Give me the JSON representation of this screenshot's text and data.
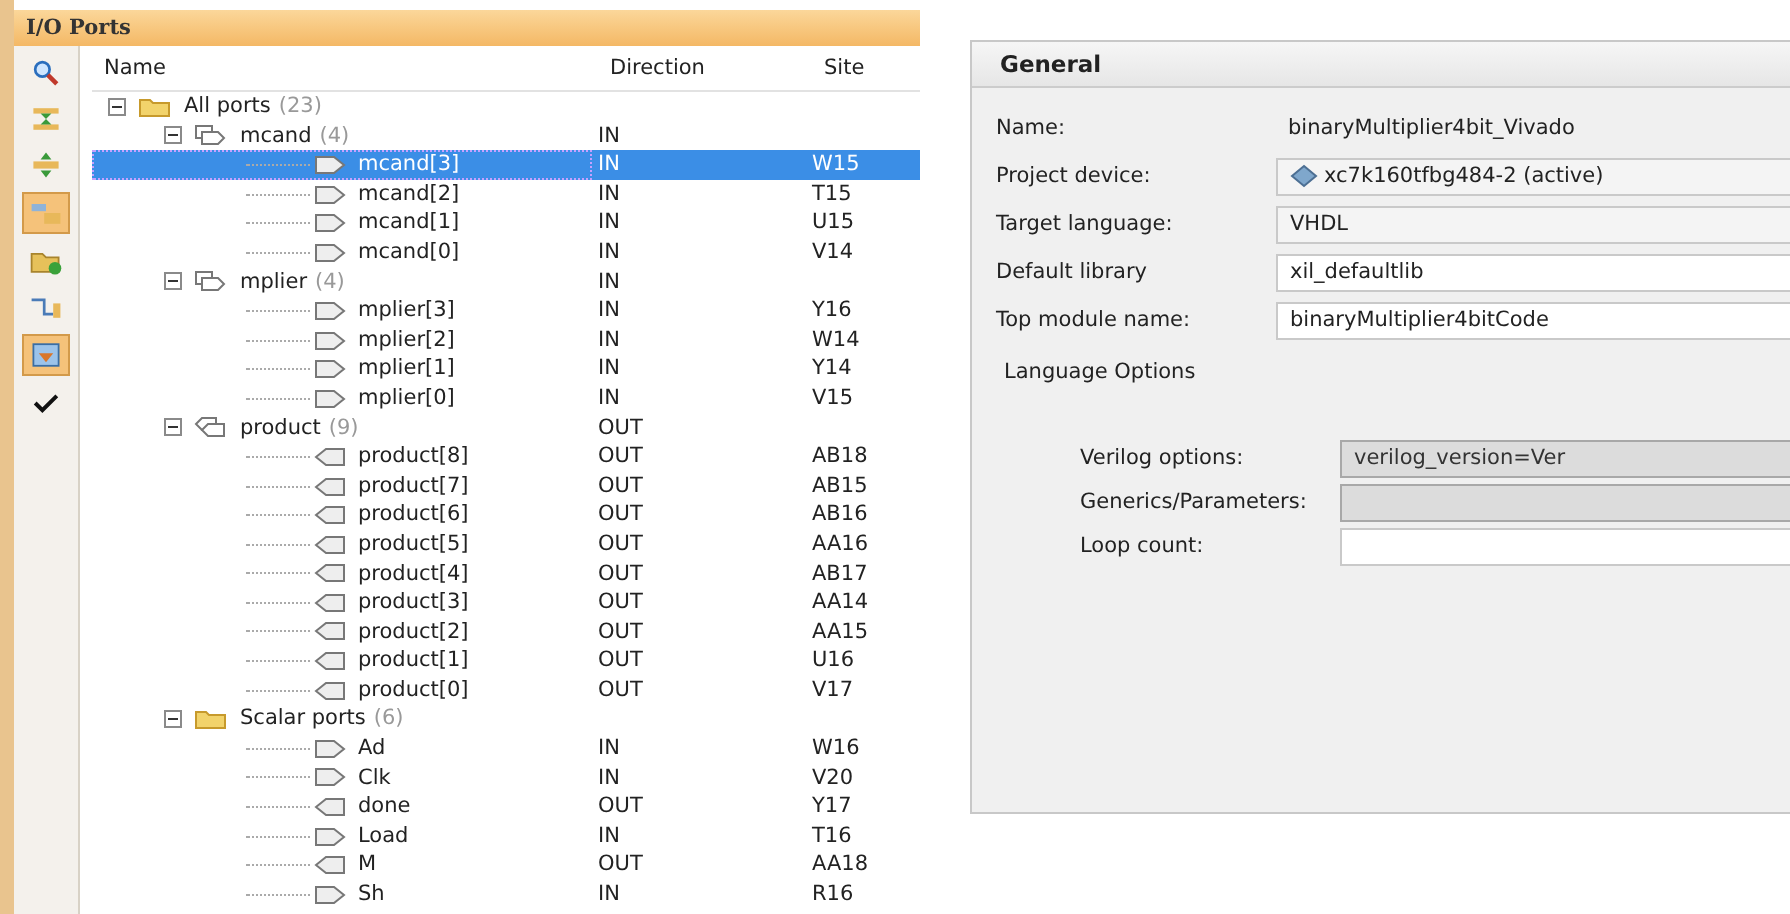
{
  "io_ports": {
    "title": "I/O Ports",
    "toolbar": [
      {
        "kind": "search",
        "on": false
      },
      {
        "kind": "collapse",
        "on": false
      },
      {
        "kind": "expand",
        "on": false
      },
      {
        "kind": "group",
        "on": true
      },
      {
        "kind": "folder_add",
        "on": false
      },
      {
        "kind": "wire",
        "on": false
      },
      {
        "kind": "import",
        "on": true
      },
      {
        "kind": "check",
        "on": false
      }
    ],
    "columns": [
      "Name",
      "Direction",
      "Site"
    ],
    "nodes": [
      {
        "kind": "folder",
        "name": "All ports",
        "count": "(23)",
        "expanded": true,
        "selected": false,
        "children": [
          {
            "kind": "bus_in",
            "name": "mcand",
            "count": "(4)",
            "direction": "IN",
            "expanded": true,
            "selected": false,
            "children": [
              {
                "kind": "in",
                "name": "mcand[3]",
                "direction": "IN",
                "site": "W15",
                "selected": true
              },
              {
                "kind": "in",
                "name": "mcand[2]",
                "direction": "IN",
                "site": "T15",
                "selected": false
              },
              {
                "kind": "in",
                "name": "mcand[1]",
                "direction": "IN",
                "site": "U15",
                "selected": false
              },
              {
                "kind": "in",
                "name": "mcand[0]",
                "direction": "IN",
                "site": "V14",
                "selected": false
              }
            ]
          },
          {
            "kind": "bus_in",
            "name": "mplier",
            "count": "(4)",
            "direction": "IN",
            "expanded": true,
            "selected": false,
            "children": [
              {
                "kind": "in",
                "name": "mplier[3]",
                "direction": "IN",
                "site": "Y16",
                "selected": false
              },
              {
                "kind": "in",
                "name": "mplier[2]",
                "direction": "IN",
                "site": "W14",
                "selected": false
              },
              {
                "kind": "in",
                "name": "mplier[1]",
                "direction": "IN",
                "site": "Y14",
                "selected": false
              },
              {
                "kind": "in",
                "name": "mplier[0]",
                "direction": "IN",
                "site": "V15",
                "selected": false
              }
            ]
          },
          {
            "kind": "bus_out",
            "name": "product",
            "count": "(9)",
            "direction": "OUT",
            "expanded": true,
            "selected": false,
            "children": [
              {
                "kind": "out",
                "name": "product[8]",
                "direction": "OUT",
                "site": "AB18",
                "selected": false
              },
              {
                "kind": "out",
                "name": "product[7]",
                "direction": "OUT",
                "site": "AB15",
                "selected": false
              },
              {
                "kind": "out",
                "name": "product[6]",
                "direction": "OUT",
                "site": "AB16",
                "selected": false
              },
              {
                "kind": "out",
                "name": "product[5]",
                "direction": "OUT",
                "site": "AA16",
                "selected": false
              },
              {
                "kind": "out",
                "name": "product[4]",
                "direction": "OUT",
                "site": "AB17",
                "selected": false
              },
              {
                "kind": "out",
                "name": "product[3]",
                "direction": "OUT",
                "site": "AA14",
                "selected": false
              },
              {
                "kind": "out",
                "name": "product[2]",
                "direction": "OUT",
                "site": "AA15",
                "selected": false
              },
              {
                "kind": "out",
                "name": "product[1]",
                "direction": "OUT",
                "site": "U16",
                "selected": false
              },
              {
                "kind": "out",
                "name": "product[0]",
                "direction": "OUT",
                "site": "V17",
                "selected": false
              }
            ]
          },
          {
            "kind": "folder",
            "name": "Scalar ports",
            "count": "(6)",
            "expanded": true,
            "selected": false,
            "children": [
              {
                "kind": "in",
                "name": "Ad",
                "direction": "IN",
                "site": "W16",
                "selected": false
              },
              {
                "kind": "in",
                "name": "Clk",
                "direction": "IN",
                "site": "V20",
                "selected": false
              },
              {
                "kind": "out",
                "name": "done",
                "direction": "OUT",
                "site": "Y17",
                "selected": false
              },
              {
                "kind": "in",
                "name": "Load",
                "direction": "IN",
                "site": "T16",
                "selected": false
              },
              {
                "kind": "out",
                "name": "M",
                "direction": "OUT",
                "site": "AA18",
                "selected": false
              },
              {
                "kind": "in",
                "name": "Sh",
                "direction": "IN",
                "site": "R16",
                "selected": false
              }
            ]
          }
        ]
      }
    ]
  },
  "general": {
    "title": "General",
    "fields": [
      {
        "kind": "plain",
        "label": "Name:",
        "value": "binaryMultiplier4bit_Vivado"
      },
      {
        "kind": "device",
        "label": "Project device:",
        "value": "xc7k160tfbg484-2 (active)"
      },
      {
        "kind": "combo",
        "label": "Target language:",
        "value": "VHDL"
      },
      {
        "kind": "input",
        "label": "Default library",
        "value": "xil_defaultlib"
      },
      {
        "kind": "input",
        "label": "Top module name:",
        "value": "binaryMultiplier4bitCode"
      }
    ],
    "section": "Language Options",
    "options": [
      {
        "label": "Verilog options:",
        "value": "verilog_version=Ver",
        "disabled": true
      },
      {
        "label": "Generics/Parameters:",
        "disabled": true
      },
      {
        "label": "Loop count:",
        "disabled": false
      }
    ]
  }
}
